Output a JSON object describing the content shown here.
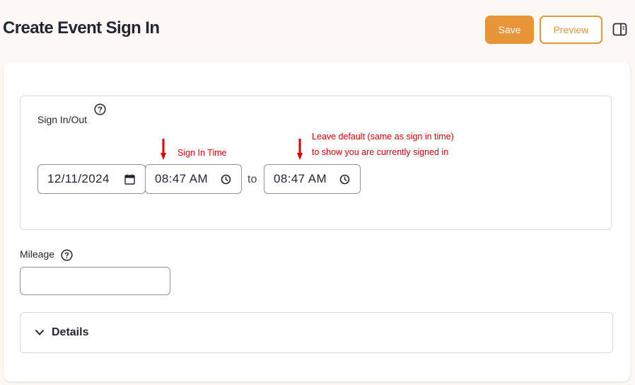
{
  "header": {
    "title": "Create Event Sign In",
    "save_label": "Save",
    "preview_label": "Preview",
    "panel_icon": "sidebar-panel-icon"
  },
  "sign_in_out": {
    "label": "Sign In/Out",
    "help_icon": "question-circle-icon",
    "date_value": "12/11/2024",
    "start_time": "08:47 AM",
    "to_label": "to",
    "end_time": "08:47 AM",
    "note_sign_in": "Sign In Time",
    "note_default_line1": "Leave default (same as sign in time)",
    "note_default_line2": "to show you are currently signed in"
  },
  "mileage": {
    "label": "Mileage",
    "value": ""
  },
  "details": {
    "label": "Details"
  },
  "colors": {
    "accent": "#e8953a",
    "annotation": "#e00000",
    "background": "#fdf8f4"
  }
}
